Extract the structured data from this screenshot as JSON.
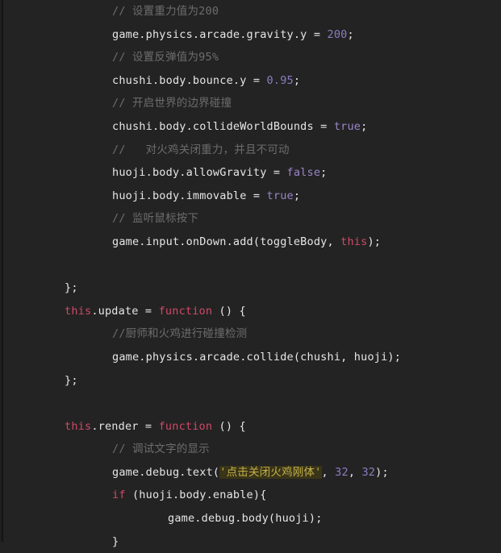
{
  "editor": {
    "theme": "dark",
    "background_color": "#232323",
    "colors": {
      "text": "#e6e6e6",
      "comment": "#6d6d6d",
      "number": "#8e7cc3",
      "constant": "#9a86c9",
      "keyword": "#cf4a68",
      "string": "#c3b14a",
      "string_highlight_bg": "#3a3418"
    },
    "language": "javascript"
  },
  "code": {
    "lines": [
      {
        "indent": 1,
        "text": "// 设置重力值为200",
        "kind": "comment"
      },
      {
        "indent": 1,
        "text": "game.physics.arcade.gravity.y = 200;",
        "kind": "statement"
      },
      {
        "indent": 1,
        "text": "// 设置反弹值为95%",
        "kind": "comment"
      },
      {
        "indent": 1,
        "text": "chushi.body.bounce.y = 0.95;",
        "kind": "statement"
      },
      {
        "indent": 1,
        "text": "// 开启世界的边界碰撞",
        "kind": "comment"
      },
      {
        "indent": 1,
        "text": "chushi.body.collideWorldBounds = true;",
        "kind": "statement"
      },
      {
        "indent": 1,
        "text": "//   对火鸡关闭重力，并且不可动",
        "kind": "comment"
      },
      {
        "indent": 1,
        "text": "huoji.body.allowGravity = false;",
        "kind": "statement"
      },
      {
        "indent": 1,
        "text": "huoji.body.immovable = true;",
        "kind": "statement"
      },
      {
        "indent": 1,
        "text": "// 监听鼠标按下",
        "kind": "comment"
      },
      {
        "indent": 1,
        "text": "game.input.onDown.add(toggleBody, this);",
        "kind": "statement"
      },
      {
        "indent": 0,
        "text": "",
        "kind": "blank"
      },
      {
        "indent": 0,
        "text": "};",
        "kind": "statement"
      },
      {
        "indent": 0,
        "text": "this.update = function () {",
        "kind": "statement"
      },
      {
        "indent": 1,
        "text": "//厨师和火鸡进行碰撞检测",
        "kind": "comment"
      },
      {
        "indent": 1,
        "text": "game.physics.arcade.collide(chushi, huoji);",
        "kind": "statement"
      },
      {
        "indent": 0,
        "text": "};",
        "kind": "statement"
      },
      {
        "indent": 0,
        "text": "",
        "kind": "blank"
      },
      {
        "indent": 0,
        "text": "this.render = function () {",
        "kind": "statement"
      },
      {
        "indent": 1,
        "text": "// 调试文字的显示",
        "kind": "comment"
      },
      {
        "indent": 1,
        "text": "game.debug.text('点击关闭火鸡刚体', 32, 32);",
        "kind": "statement"
      },
      {
        "indent": 1,
        "text": "if (huoji.body.enable){",
        "kind": "statement"
      },
      {
        "indent": 2,
        "text": "game.debug.body(huoji);",
        "kind": "statement"
      },
      {
        "indent": 1,
        "text": "}",
        "kind": "statement"
      }
    ],
    "tokens": [
      [
        {
          "t": "// 设置重力值为200",
          "c": "comment"
        }
      ],
      [
        {
          "t": "game.physics.arcade.gravity.y = ",
          "c": "plain"
        },
        {
          "t": "200",
          "c": "number"
        },
        {
          "t": ";",
          "c": "punct"
        }
      ],
      [
        {
          "t": "// 设置反弹值为95%",
          "c": "comment"
        }
      ],
      [
        {
          "t": "chushi.body.bounce.y = ",
          "c": "plain"
        },
        {
          "t": "0.95",
          "c": "number"
        },
        {
          "t": ";",
          "c": "punct"
        }
      ],
      [
        {
          "t": "// 开启世界的边界碰撞",
          "c": "comment"
        }
      ],
      [
        {
          "t": "chushi.body.collideWorldBounds = ",
          "c": "plain"
        },
        {
          "t": "true",
          "c": "const"
        },
        {
          "t": ";",
          "c": "punct"
        }
      ],
      [
        {
          "t": "//   对火鸡关闭重力，并且不可动",
          "c": "comment"
        }
      ],
      [
        {
          "t": "huoji.body.allowGravity = ",
          "c": "plain"
        },
        {
          "t": "false",
          "c": "const"
        },
        {
          "t": ";",
          "c": "punct"
        }
      ],
      [
        {
          "t": "huoji.body.immovable = ",
          "c": "plain"
        },
        {
          "t": "true",
          "c": "const"
        },
        {
          "t": ";",
          "c": "punct"
        }
      ],
      [
        {
          "t": "// 监听鼠标按下",
          "c": "comment"
        }
      ],
      [
        {
          "t": "game.input.onDown.add(toggleBody, ",
          "c": "plain"
        },
        {
          "t": "this",
          "c": "this"
        },
        {
          "t": ");",
          "c": "punct"
        }
      ],
      [],
      [
        {
          "t": "};",
          "c": "plain"
        }
      ],
      [
        {
          "t": "this",
          "c": "this"
        },
        {
          "t": ".update = ",
          "c": "plain"
        },
        {
          "t": "function",
          "c": "keyword"
        },
        {
          "t": " () {",
          "c": "plain"
        }
      ],
      [
        {
          "t": "//厨师和火鸡进行碰撞检测",
          "c": "comment"
        }
      ],
      [
        {
          "t": "game.physics.arcade.collide(chushi, huoji);",
          "c": "plain"
        }
      ],
      [
        {
          "t": "};",
          "c": "plain"
        }
      ],
      [],
      [
        {
          "t": "this",
          "c": "this"
        },
        {
          "t": ".render = ",
          "c": "plain"
        },
        {
          "t": "function",
          "c": "keyword"
        },
        {
          "t": " () {",
          "c": "plain"
        }
      ],
      [
        {
          "t": "// 调试文字的显示",
          "c": "comment"
        }
      ],
      [
        {
          "t": "game.debug.text(",
          "c": "plain"
        },
        {
          "t": "'点击关闭火鸡刚体'",
          "c": "string"
        },
        {
          "t": ", ",
          "c": "plain"
        },
        {
          "t": "32",
          "c": "number"
        },
        {
          "t": ", ",
          "c": "plain"
        },
        {
          "t": "32",
          "c": "number"
        },
        {
          "t": ");",
          "c": "punct"
        }
      ],
      [
        {
          "t": "if",
          "c": "keyword"
        },
        {
          "t": " (huoji.body.enable){",
          "c": "plain"
        }
      ],
      [
        {
          "t": "game.debug.body(huoji);",
          "c": "plain"
        }
      ],
      [
        {
          "t": "}",
          "c": "plain"
        }
      ]
    ]
  }
}
